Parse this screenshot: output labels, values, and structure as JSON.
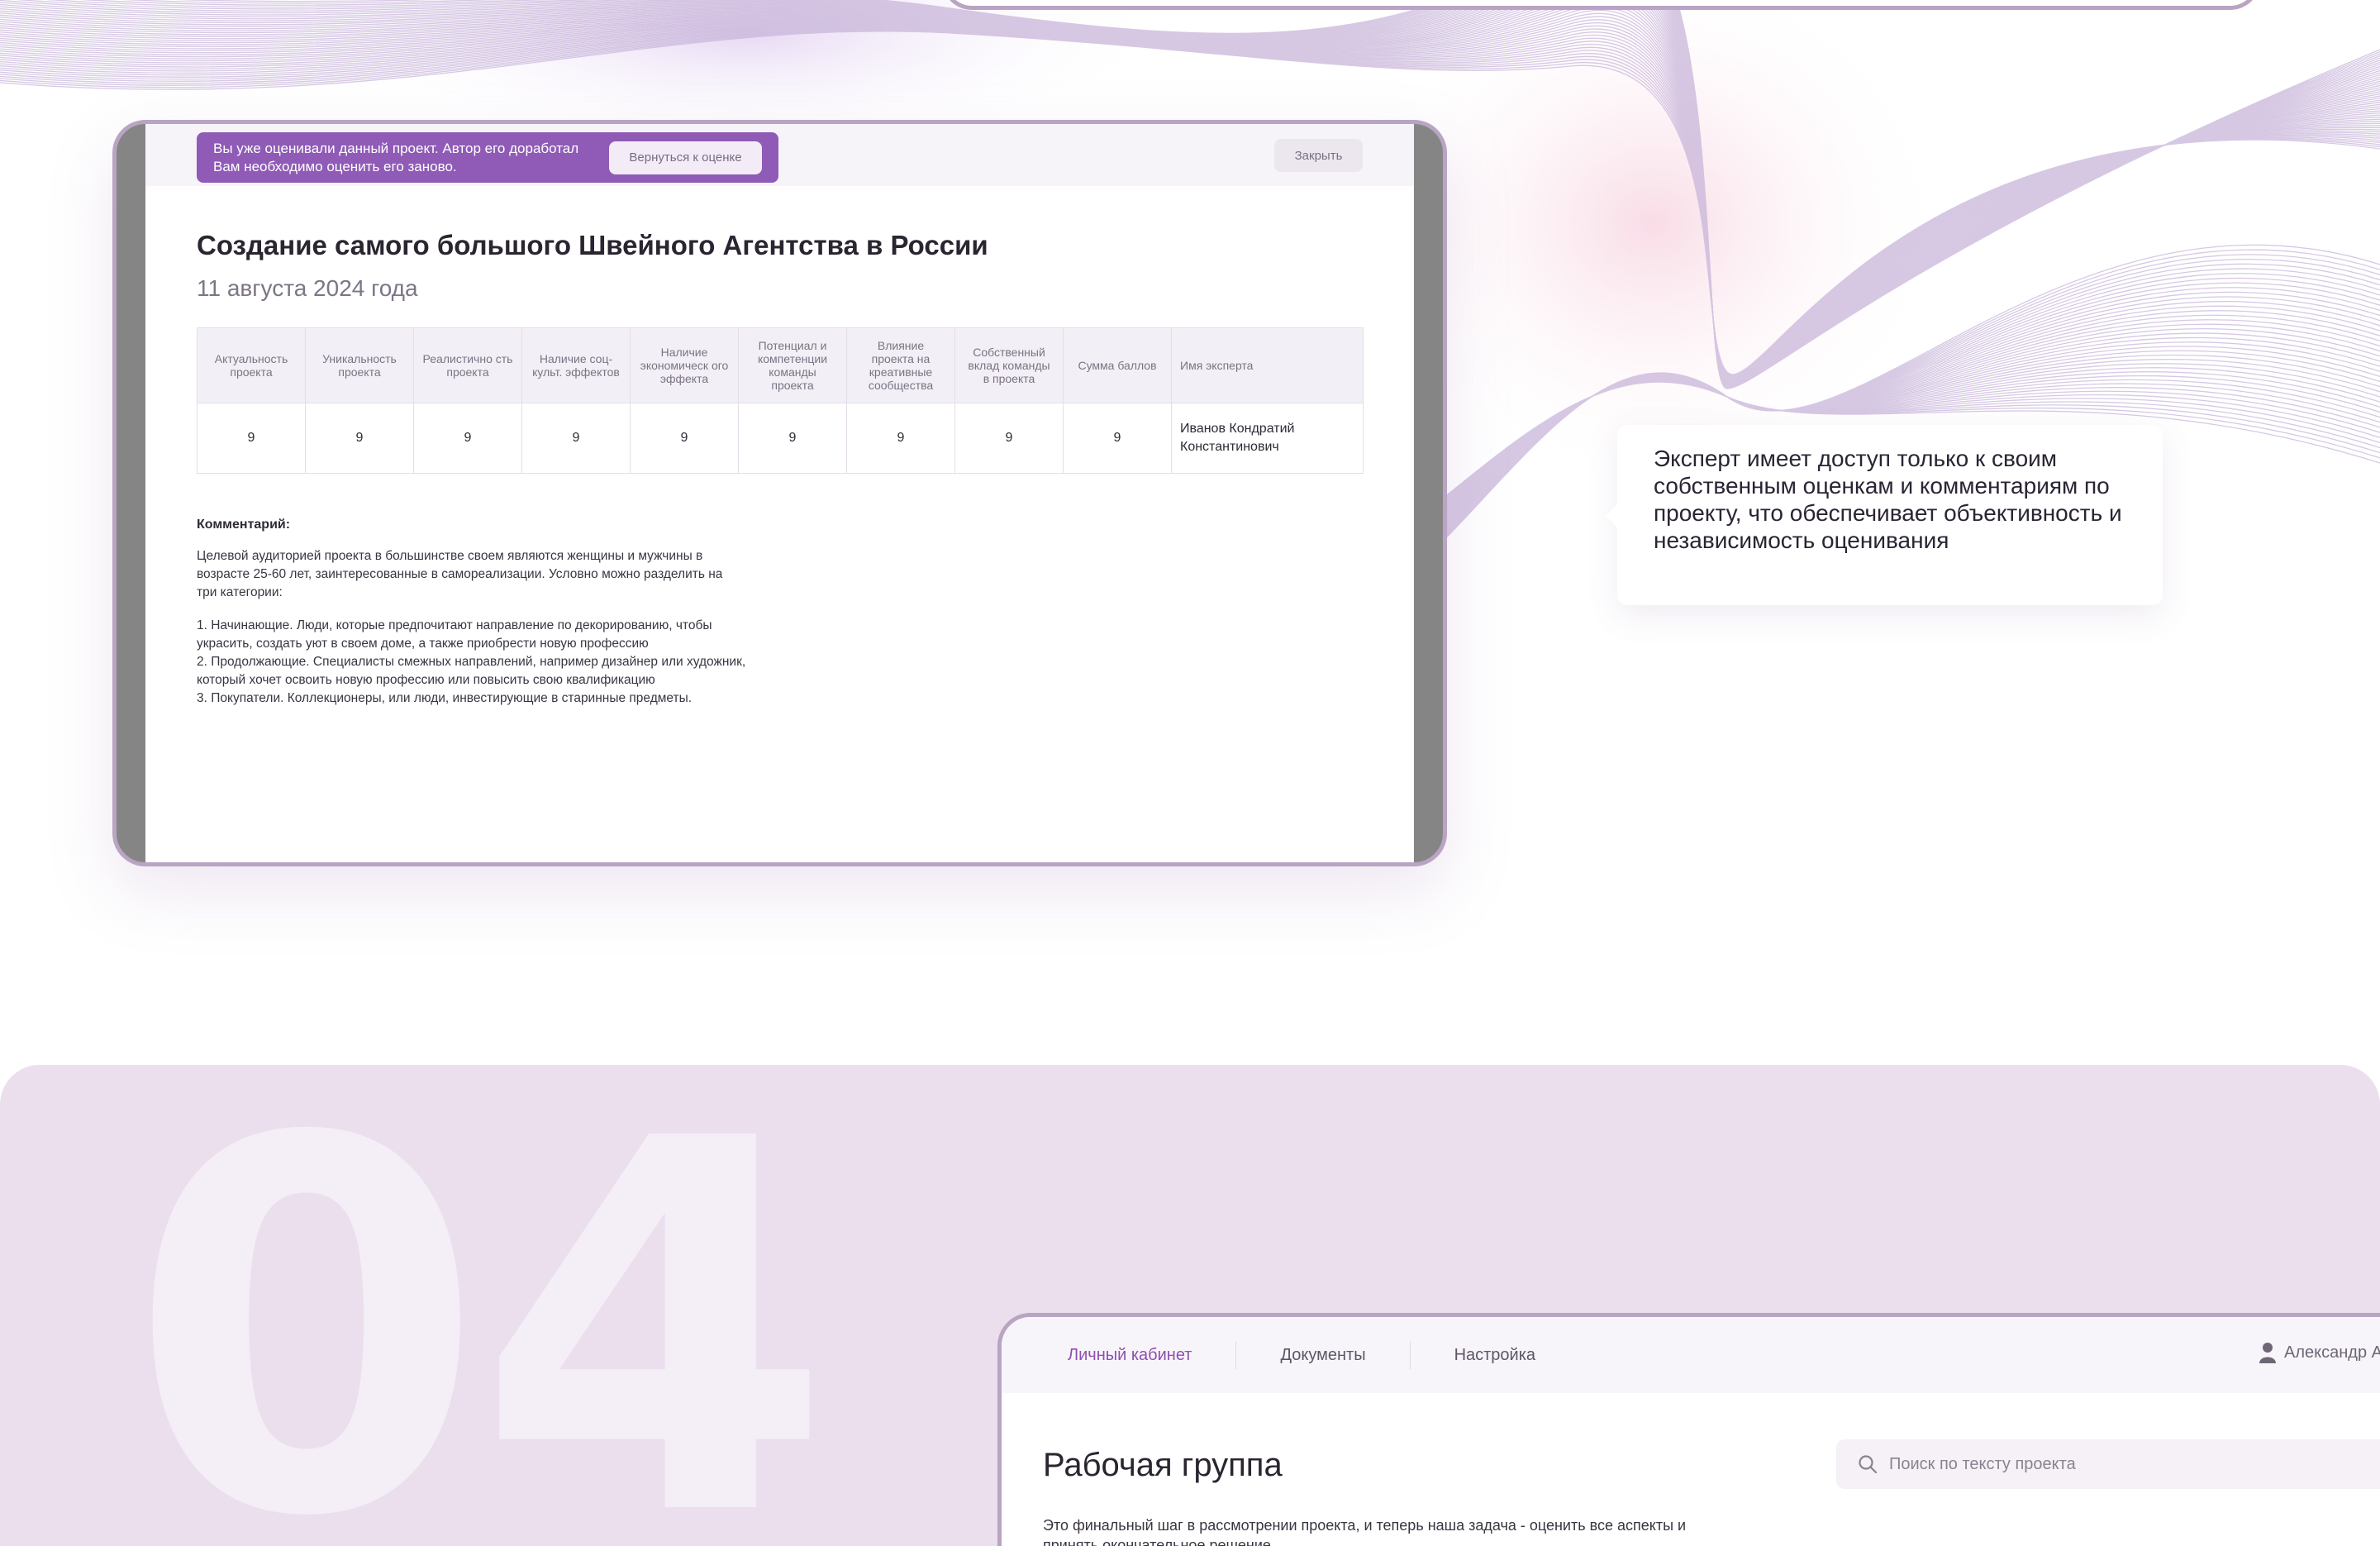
{
  "evaluation": {
    "notice_text": "Вы уже оценивали данный проект. Автор его доработал\nВам необходимо оценить его заново.",
    "return_button": "Вернуться к оценке",
    "close_button": "Закрыть",
    "project_title": "Создание самого большого Швейного Агентства в России",
    "project_date": "11 августа 2024 года",
    "table": {
      "headers": [
        "Актуальность проекта",
        "Уникальность проекта",
        "Реалистично сть проекта",
        "Наличие соц-культ. эффектов",
        "Наличие экономическ ого эффекта",
        "Потенциал и компетенции команды проекта",
        "Влияние проекта на креативные сообщества",
        "Собственный вклад команды в проекта",
        "Сумма баллов",
        "Имя эксперта"
      ],
      "row": [
        "9",
        "9",
        "9",
        "9",
        "9",
        "9",
        "9",
        "9",
        "9",
        "Иванов Кондратий Константинович"
      ]
    },
    "comment_label": "Комментарий:",
    "comment_paragraphs": [
      "Целевой аудиторией проекта в большинстве своем являются женщины и мужчины в\nвозрасте 25-60 лет, заинтересованные в самореализации. Условно можно разделить на\nтри категории:",
      "1. Начинающие. Люди, которые предпочитают направление по декорированию, чтобы\nукрасить, создать уют в своем доме, а также приобрести новую профессию\n2. Продолжающие. Специалисты смежных направлений, например дизайнер или художник,\nкоторый хочет освоить новую профессию или повысить свою квалификацию\n3. Покупатели. Коллекционеры, или люди, инвестирующие в старинные предметы."
    ]
  },
  "callout": {
    "text": "Эксперт имеет доступ только к своим собственным оценкам и комментариям по проекту, что обеспечивает объективность и независимость оценивания"
  },
  "section": {
    "number": "04"
  },
  "app": {
    "nav": [
      "Личный кабинет",
      "Документы",
      "Настройка"
    ],
    "user_name": "Александр А.",
    "page_title": "Рабочая группа",
    "search_placeholder": "Поиск по тексту проекта",
    "description": "Это финальный шаг в рассмотрении проекта, и теперь наша задача - оценить все аспекты и принять окончательное решение."
  },
  "colors": {
    "accent": "#8f5bb6",
    "frame_border": "#b9a4c4",
    "section_bg": "#ebdfee",
    "nav_active": "#8d4fb3"
  },
  "icons": {
    "search": "search-icon",
    "user": "user-icon"
  }
}
